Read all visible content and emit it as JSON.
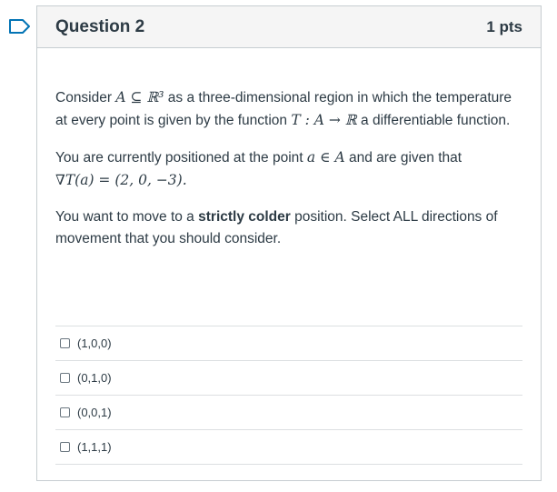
{
  "question": {
    "title": "Question 2",
    "points": "1 pts"
  },
  "body": {
    "p1_a": "Consider",
    "p1_set": "A ⊆ ℝ³",
    "p1_b": "as a three-dimensional region in which the temperature at every point is given by the function",
    "p1_func": "T : A → ℝ",
    "p1_c": "a differentiable function.",
    "p2_a": "You are currently positioned at the point",
    "p2_point": "a ∈ A",
    "p2_b": "and are given that",
    "p2_grad": "∇T(a) = (2, 0, −3).",
    "p3_a": "You want to move to a",
    "p3_bold": "strictly colder",
    "p3_b": "position. Select ALL directions of movement that you should consider."
  },
  "answers": [
    {
      "label": "(1,0,0)",
      "checked": false
    },
    {
      "label": "(0,1,0)",
      "checked": false
    },
    {
      "label": "(0,0,1)",
      "checked": false
    },
    {
      "label": "(1,1,1)",
      "checked": false
    }
  ],
  "colors": {
    "flag": "#0374b5",
    "text": "#2d3b45",
    "header_bg": "#f5f5f5",
    "border": "#c7cdd1"
  },
  "icons": {
    "flag": "flag-question-icon"
  }
}
